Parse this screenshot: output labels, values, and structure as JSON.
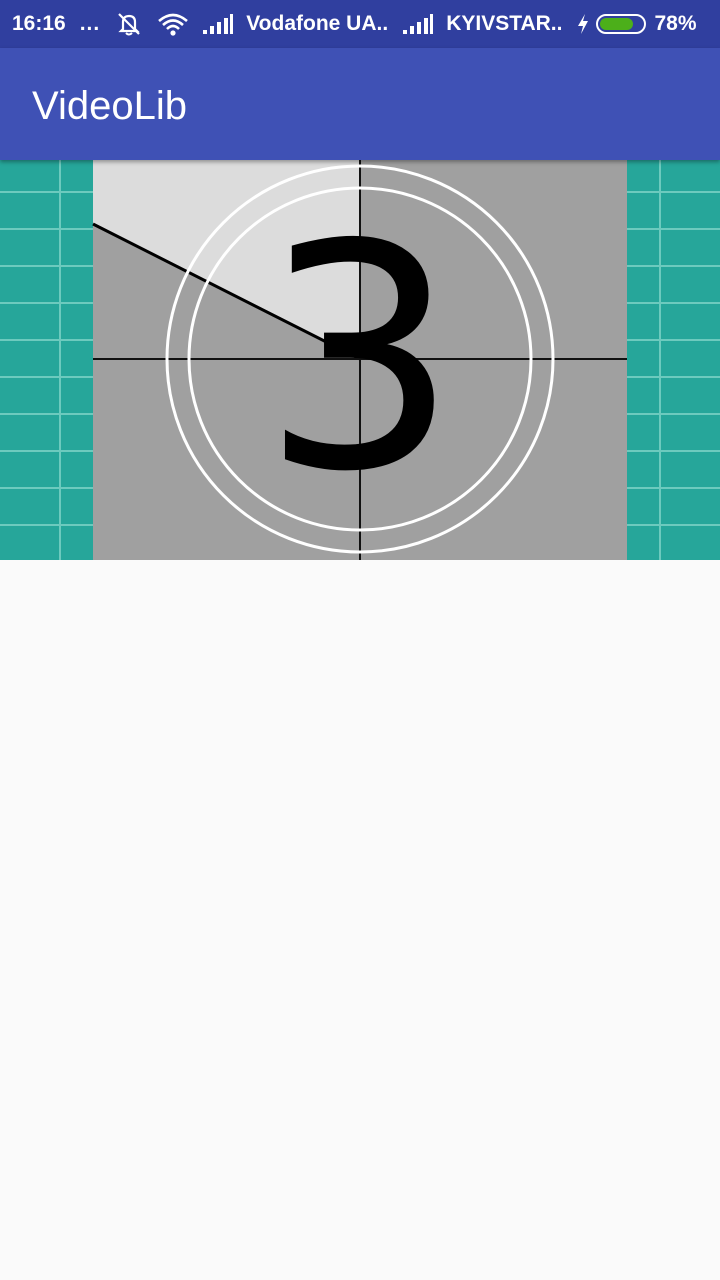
{
  "status_bar": {
    "time": "16:16",
    "dots": "...",
    "carrier1": "Vodafone UA..",
    "carrier2": "KYIVSTAR..",
    "battery_percent": "78%",
    "battery_level": 0.78,
    "icons": [
      "notifications-muted-icon",
      "wifi-icon",
      "signal-icon",
      "signal-icon",
      "charging-icon",
      "battery-icon"
    ]
  },
  "app_bar": {
    "title": "VideoLib"
  },
  "video": {
    "countdown_number": "3",
    "colors": {
      "background": "#26a69a",
      "frame": "#a0a0a0",
      "sweep": "#dcdcdc",
      "rings": "#ffffff"
    }
  },
  "colors": {
    "primary": "#3f51b5",
    "primary_dark": "#303f9f",
    "page_background": "#fafafa"
  }
}
